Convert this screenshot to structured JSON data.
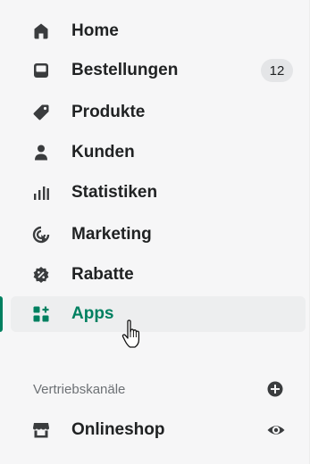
{
  "nav": {
    "items": [
      {
        "label": "Home",
        "icon": "home-icon"
      },
      {
        "label": "Bestellungen",
        "icon": "inbox-icon",
        "badge": "12"
      },
      {
        "label": "Produkte",
        "icon": "tag-icon"
      },
      {
        "label": "Kunden",
        "icon": "person-icon"
      },
      {
        "label": "Statistiken",
        "icon": "bar-chart-icon"
      },
      {
        "label": "Marketing",
        "icon": "target-icon"
      },
      {
        "label": "Rabatte",
        "icon": "discount-icon"
      },
      {
        "label": "Apps",
        "icon": "apps-icon",
        "active": true
      }
    ]
  },
  "sales_channels": {
    "title": "Vertriebskanäle",
    "add_icon": "plus-circle-icon",
    "items": [
      {
        "label": "Onlineshop",
        "icon": "store-icon",
        "action_icon": "eye-icon"
      }
    ]
  },
  "colors": {
    "accent": "#008060",
    "text": "#202223",
    "muted": "#6d7175",
    "background": "#f6f6f7",
    "active_background": "#edeeef",
    "badge_background": "#e4e5e7"
  }
}
